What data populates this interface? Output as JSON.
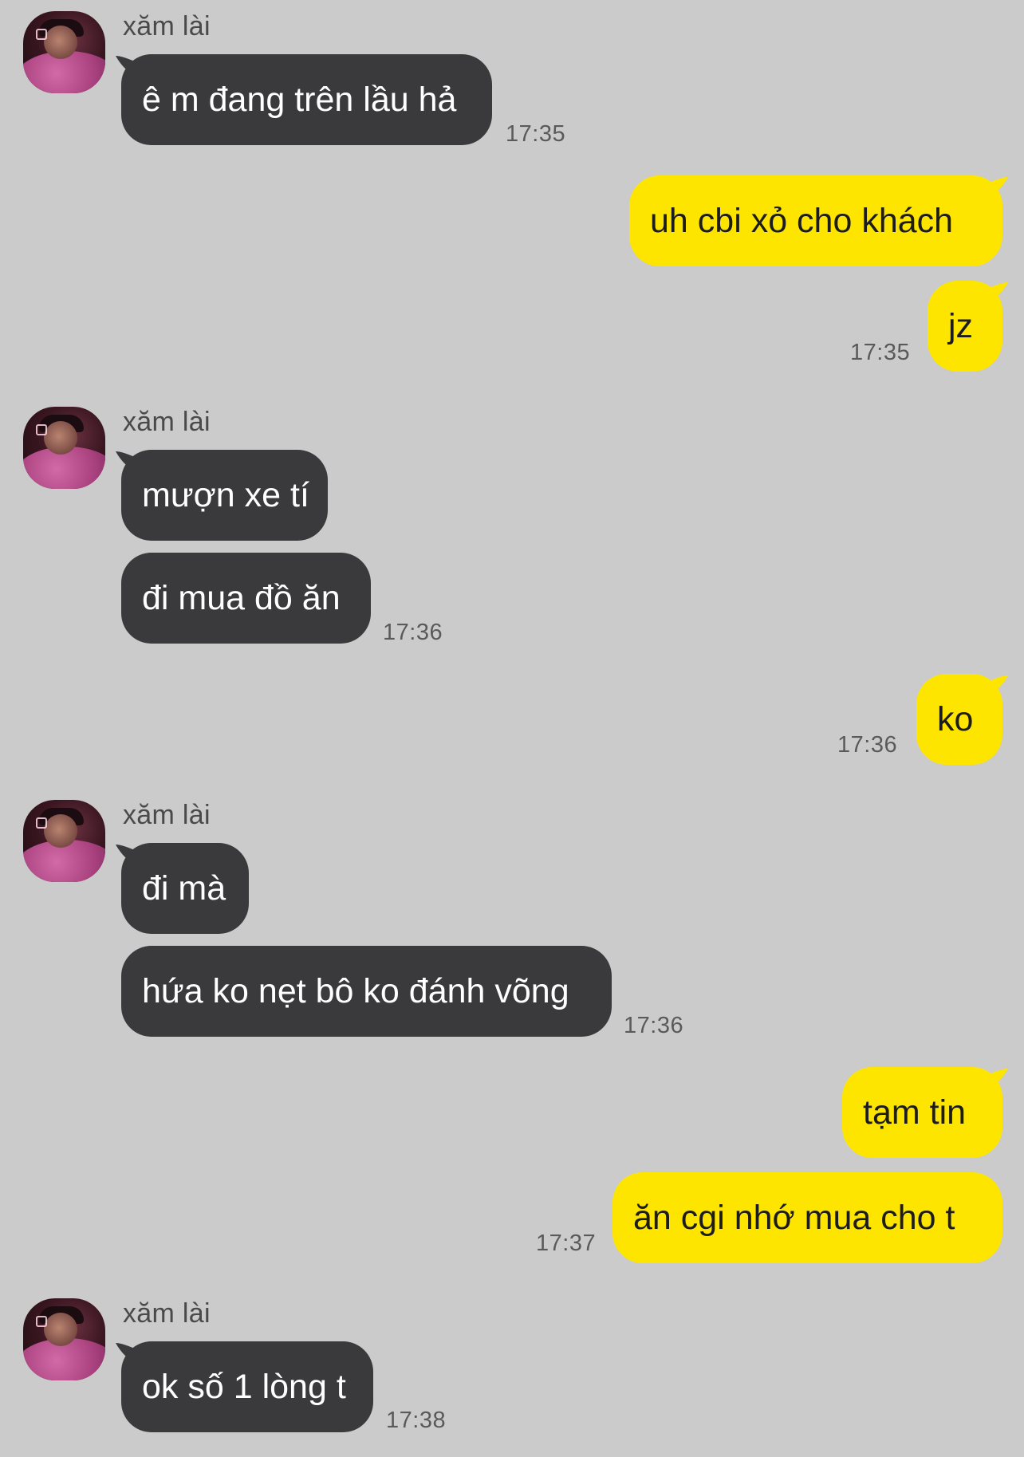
{
  "chat": {
    "sender_name": "xăm lài",
    "colors": {
      "background": "#cbcbcb",
      "incoming_bubble": "#3a3a3c",
      "outgoing_bubble": "#fee500"
    },
    "messages": [
      {
        "dir": "in",
        "text": "ê m đang trên lầu hả",
        "time": "17:35",
        "avatar": "profile-avatar"
      },
      {
        "dir": "out",
        "text": "uh cbi xỏ cho khách",
        "time": ""
      },
      {
        "dir": "out",
        "text": "jz",
        "time": "17:35"
      },
      {
        "dir": "in",
        "text": "mượn xe tí",
        "time": "",
        "avatar": "profile-avatar"
      },
      {
        "dir": "in",
        "text": "đi mua đồ ăn",
        "time": "17:36"
      },
      {
        "dir": "out",
        "text": "ko",
        "time": "17:36"
      },
      {
        "dir": "in",
        "text": "đi mà",
        "time": "",
        "avatar": "profile-avatar"
      },
      {
        "dir": "in",
        "text": "hứa ko nẹt bô ko đánh võng",
        "time": "17:36"
      },
      {
        "dir": "out",
        "text": "tạm tin",
        "time": ""
      },
      {
        "dir": "out",
        "text": "ăn cgi nhớ mua cho t",
        "time": "17:37"
      },
      {
        "dir": "in",
        "text": "ok số 1 lòng t",
        "time": "17:38",
        "avatar": "profile-avatar"
      }
    ]
  }
}
